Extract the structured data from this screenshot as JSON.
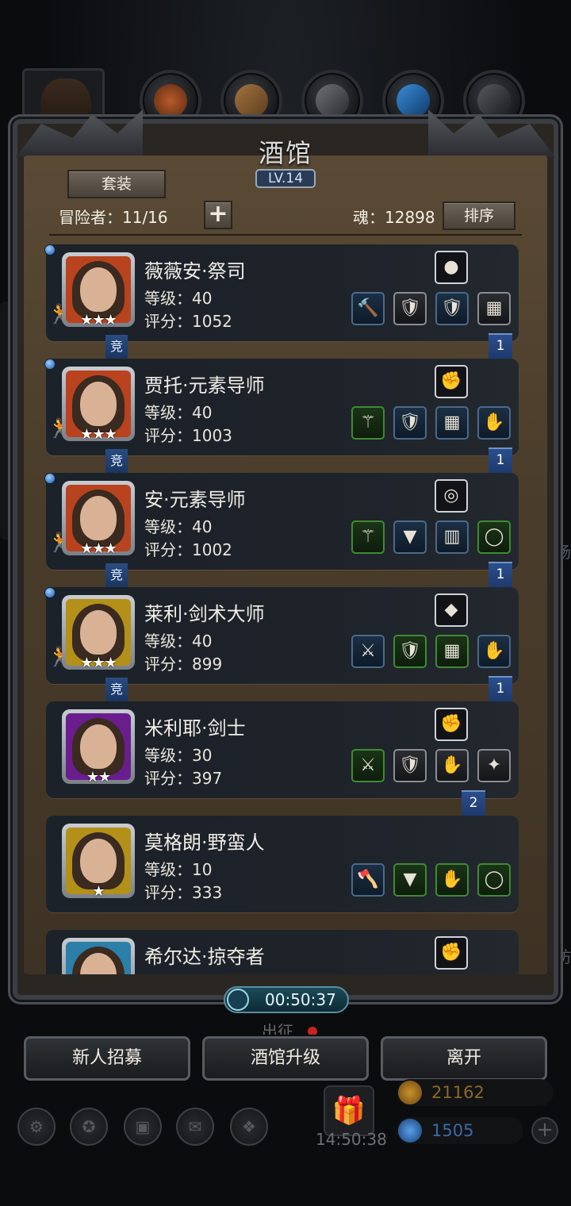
{
  "window": {
    "title": "酒馆",
    "level": "LV.14"
  },
  "header": {
    "suit_label": "套装",
    "adventurers_label": "冒险者：11/16",
    "add_label": "+",
    "soul_label": "魂：12898",
    "sort_label": "排序"
  },
  "heroes": [
    {
      "name": "薇薇安·祭司",
      "level": "等级：40",
      "score": "评分：1052",
      "stars": "★★★",
      "badge": "1",
      "arena": "竞",
      "frame_color": "#b8431e",
      "slots": [
        "hammer-icon",
        "armor-icon",
        "shield-icon",
        "chest-icon"
      ],
      "top_item": "egg-icon"
    },
    {
      "name": "贾托·元素导师",
      "level": "等级：40",
      "score": "评分：1003",
      "stars": "★★★",
      "badge": "1",
      "arena": "竞",
      "frame_color": "#b8431e",
      "slots": [
        "staff-icon",
        "armor-icon",
        "chest-icon",
        "gauntlet-icon"
      ],
      "top_item": "glove-icon"
    },
    {
      "name": "安·元素导师",
      "level": "等级：40",
      "score": "评分：1002",
      "stars": "★★★",
      "badge": "1",
      "arena": "竞",
      "frame_color": "#b8431e",
      "slots": [
        "staff-icon",
        "cloak-icon",
        "plank-icon",
        "ring-icon"
      ],
      "top_item": "disc-icon"
    },
    {
      "name": "莱利·剑术大师",
      "level": "等级：40",
      "score": "评分：899",
      "stars": "★★★",
      "badge": "1",
      "arena": "竞",
      "frame_color": "#b39018",
      "slots": [
        "sword-icon",
        "armor-icon",
        "chest-icon",
        "gauntlet-icon"
      ],
      "top_item": "crystal-icon"
    },
    {
      "name": "米利耶·剑士",
      "level": "等级：30",
      "score": "评分：397",
      "stars": "★★",
      "badge": "2",
      "arena": "",
      "frame_color": "#6a1e8e",
      "slots": [
        "sword-icon",
        "armor-icon",
        "gauntlet-icon",
        "amulet-icon"
      ],
      "top_item": "glove-icon"
    },
    {
      "name": "莫格朗·野蛮人",
      "level": "等级：10",
      "score": "评分：333",
      "stars": "★",
      "badge": "",
      "arena": "",
      "frame_color": "#b39018",
      "slots": [
        "axe-icon",
        "cloak-icon",
        "gauntlet-icon",
        "ring-icon"
      ],
      "top_item": ""
    },
    {
      "name": "希尔达·掠夺者",
      "level": "",
      "score": "",
      "stars": "",
      "badge": "",
      "arena": "",
      "frame_color": "#2b7fa8",
      "slots": [],
      "top_item": "glove-icon"
    }
  ],
  "timer": "00:50:37",
  "buttons": {
    "recruit": "新人招募",
    "upgrade": "酒馆升级",
    "leave": "离开"
  },
  "background": {
    "expedition": "出征",
    "gift_time": "14:50:38",
    "gold": "21162",
    "gems": "1505",
    "side_label_1": "技场",
    "side_label_2": "工坊"
  }
}
